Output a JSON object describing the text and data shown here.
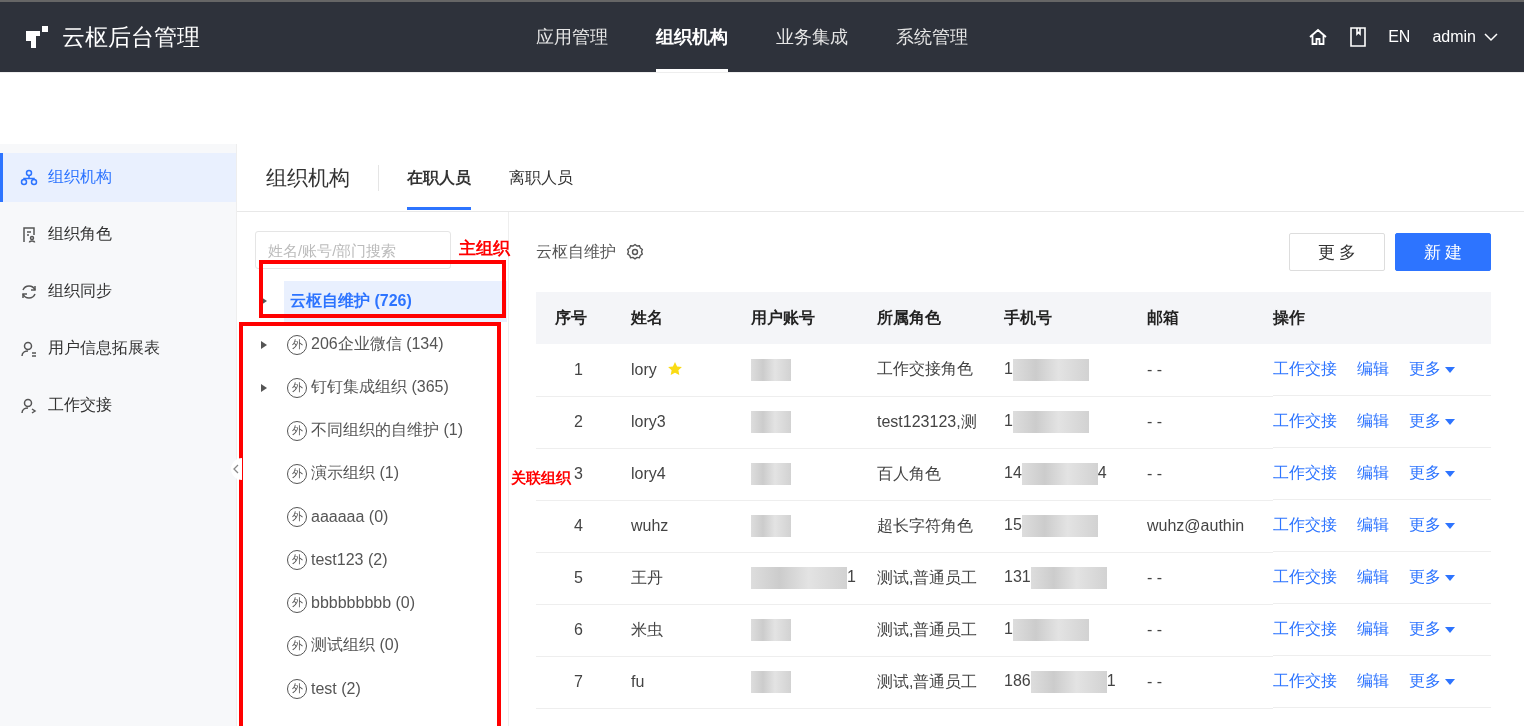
{
  "header": {
    "brand": "云枢后台管理",
    "nav": [
      {
        "label": "应用管理",
        "selected": false
      },
      {
        "label": "组织机构",
        "selected": true
      },
      {
        "label": "业务集成",
        "selected": false
      },
      {
        "label": "系统管理",
        "selected": false
      }
    ],
    "lang": "EN",
    "user": "admin"
  },
  "sidebar": {
    "items": [
      {
        "label": "组织机构",
        "selected": true
      },
      {
        "label": "组织角色",
        "selected": false
      },
      {
        "label": "组织同步",
        "selected": false
      },
      {
        "label": "用户信息拓展表",
        "selected": false
      },
      {
        "label": "工作交接",
        "selected": false
      }
    ]
  },
  "page": {
    "title": "组织机构",
    "tabs": [
      {
        "label": "在职人员",
        "selected": true
      },
      {
        "label": "离职人员",
        "selected": false
      }
    ]
  },
  "tree": {
    "search": {
      "placeholder": "姓名/账号/部门搜索"
    },
    "items": [
      {
        "label": "云枢自维护 (726)",
        "expandable": true,
        "selected": true
      },
      {
        "label": "206企业微信 (134)",
        "badge": "外",
        "expandable": true,
        "selected": false
      },
      {
        "label": "钉钉集成组织 (365)",
        "badge": "外",
        "expandable": true,
        "selected": false
      },
      {
        "label": "不同组织的自维护 (1)",
        "badge": "外",
        "expandable": false,
        "selected": false
      },
      {
        "label": "演示组织 (1)",
        "badge": "外",
        "expandable": false,
        "selected": false
      },
      {
        "label": "aaaaaa (0)",
        "badge": "外",
        "expandable": false,
        "selected": false
      },
      {
        "label": "test123 (2)",
        "badge": "外",
        "expandable": false,
        "selected": false
      },
      {
        "label": "bbbbbbbbb (0)",
        "badge": "外",
        "expandable": false,
        "selected": false
      },
      {
        "label": "测试组织 (0)",
        "badge": "外",
        "expandable": false,
        "selected": false
      },
      {
        "label": "test (2)",
        "badge": "外",
        "expandable": false,
        "selected": false
      }
    ]
  },
  "annotations": [
    {
      "label": "主组织"
    },
    {
      "label": "关联组织"
    }
  ],
  "content": {
    "org_name": "云枢自维护",
    "buttons": [
      {
        "label": "更 多",
        "kind": "default"
      },
      {
        "label": "新 建",
        "kind": "primary"
      }
    ],
    "table": {
      "columns": [
        "序号",
        "姓名",
        "用户账号",
        "所属角色",
        "手机号",
        "邮箱",
        "操作"
      ],
      "rows": [
        {
          "index": "1",
          "name": "lory",
          "starred": true,
          "account_suffix": "",
          "role": "工作交接角色",
          "phone_prefix": "1",
          "phone_suffix": "",
          "email": "- -",
          "actions": [
            "工作交接",
            "编辑",
            "更多"
          ]
        },
        {
          "index": "2",
          "name": "lory3",
          "starred": false,
          "account_suffix": "",
          "role": "test123123,测",
          "phone_prefix": "1",
          "phone_suffix": "",
          "email": "- -",
          "actions": [
            "工作交接",
            "编辑",
            "更多"
          ]
        },
        {
          "index": "3",
          "name": "lory4",
          "starred": false,
          "account_suffix": "",
          "role": "百人角色",
          "phone_prefix": "14",
          "phone_suffix": "4",
          "email": "- -",
          "actions": [
            "工作交接",
            "编辑",
            "更多"
          ]
        },
        {
          "index": "4",
          "name": "wuhz",
          "starred": false,
          "account_suffix": "",
          "role": "超长字符角色",
          "phone_prefix": "15",
          "phone_suffix": "",
          "email": "wuhz@authin",
          "actions": [
            "工作交接",
            "编辑",
            "更多"
          ]
        },
        {
          "index": "5",
          "name": "王丹",
          "starred": false,
          "account_suffix": "1",
          "role": "测试,普通员工",
          "phone_prefix": "131",
          "phone_suffix": "",
          "email": "- -",
          "actions": [
            "工作交接",
            "编辑",
            "更多"
          ]
        },
        {
          "index": "6",
          "name": "米虫",
          "starred": false,
          "account_suffix": "",
          "role": "测试,普通员工",
          "phone_prefix": "1",
          "phone_suffix": "",
          "email": "- -",
          "actions": [
            "工作交接",
            "编辑",
            "更多"
          ]
        },
        {
          "index": "7",
          "name": "fu",
          "starred": false,
          "account_suffix": "",
          "role": "测试,普通员工",
          "phone_prefix": "186",
          "phone_suffix": "1",
          "email": "- -",
          "actions": [
            "工作交接",
            "编辑",
            "更多"
          ]
        }
      ]
    }
  }
}
